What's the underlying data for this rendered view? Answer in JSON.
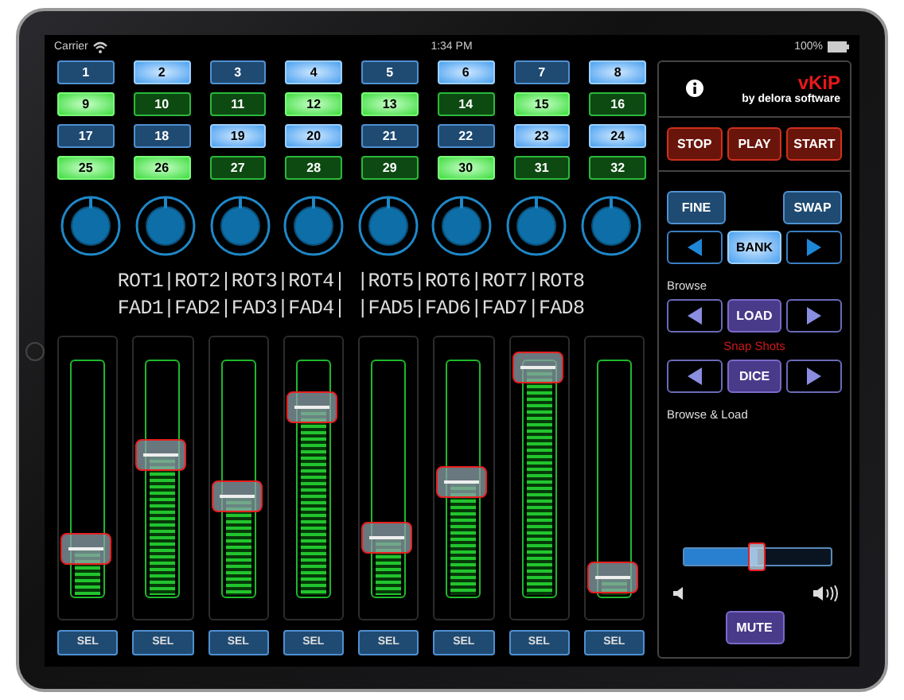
{
  "status_bar": {
    "carrier": "Carrier",
    "time": "1:34 PM",
    "battery": "100%"
  },
  "pads": [
    {
      "label": "1",
      "kind": "blue",
      "lit": false
    },
    {
      "label": "2",
      "kind": "blue",
      "lit": true
    },
    {
      "label": "3",
      "kind": "blue",
      "lit": false
    },
    {
      "label": "4",
      "kind": "blue",
      "lit": true
    },
    {
      "label": "5",
      "kind": "blue",
      "lit": false
    },
    {
      "label": "6",
      "kind": "blue",
      "lit": true
    },
    {
      "label": "7",
      "kind": "blue",
      "lit": false
    },
    {
      "label": "8",
      "kind": "blue",
      "lit": true
    },
    {
      "label": "9",
      "kind": "green",
      "lit": true
    },
    {
      "label": "10",
      "kind": "green",
      "lit": false
    },
    {
      "label": "11",
      "kind": "green",
      "lit": false
    },
    {
      "label": "12",
      "kind": "green",
      "lit": true
    },
    {
      "label": "13",
      "kind": "green",
      "lit": true
    },
    {
      "label": "14",
      "kind": "green",
      "lit": false
    },
    {
      "label": "15",
      "kind": "green",
      "lit": true
    },
    {
      "label": "16",
      "kind": "green",
      "lit": false
    },
    {
      "label": "17",
      "kind": "blue",
      "lit": false
    },
    {
      "label": "18",
      "kind": "blue",
      "lit": false
    },
    {
      "label": "19",
      "kind": "blue",
      "lit": true
    },
    {
      "label": "20",
      "kind": "blue",
      "lit": true
    },
    {
      "label": "21",
      "kind": "blue",
      "lit": false
    },
    {
      "label": "22",
      "kind": "blue",
      "lit": false
    },
    {
      "label": "23",
      "kind": "blue",
      "lit": true
    },
    {
      "label": "24",
      "kind": "blue",
      "lit": true
    },
    {
      "label": "25",
      "kind": "green",
      "lit": true
    },
    {
      "label": "26",
      "kind": "green",
      "lit": true
    },
    {
      "label": "27",
      "kind": "green",
      "lit": false
    },
    {
      "label": "28",
      "kind": "green",
      "lit": false
    },
    {
      "label": "29",
      "kind": "green",
      "lit": false
    },
    {
      "label": "30",
      "kind": "green",
      "lit": true
    },
    {
      "label": "31",
      "kind": "green",
      "lit": false
    },
    {
      "label": "32",
      "kind": "green",
      "lit": false
    }
  ],
  "assign_labels": [
    "ROT1|ROT2|ROT3|ROT4| |ROT5|ROT6|ROT7|ROT8",
    "FAD1|FAD2|FAD3|FAD4| |FAD5|FAD6|FAD7|FAD8"
  ],
  "faders": [
    {
      "level": 0.2,
      "button": "SEL"
    },
    {
      "level": 0.6,
      "button": "SEL"
    },
    {
      "level": 0.42,
      "button": "SEL"
    },
    {
      "level": 0.8,
      "button": "SEL"
    },
    {
      "level": 0.25,
      "button": "SEL"
    },
    {
      "level": 0.48,
      "button": "SEL"
    },
    {
      "level": 0.97,
      "button": "SEL"
    },
    {
      "level": 0.08,
      "button": "SEL"
    }
  ],
  "panel": {
    "title": "vKiP",
    "subtitle": "by delora software",
    "transport": [
      "STOP",
      "PLAY",
      "START"
    ],
    "fine": "FINE",
    "swap": "SWAP",
    "bank": {
      "label": "BANK",
      "lit": true
    },
    "browse_label": "Browse",
    "load": "LOAD",
    "snapshots_label": "Snap Shots",
    "dice": "DICE",
    "browse_load_label": "Browse & Load",
    "volume": {
      "level": 0.5
    },
    "mute": "MUTE"
  }
}
